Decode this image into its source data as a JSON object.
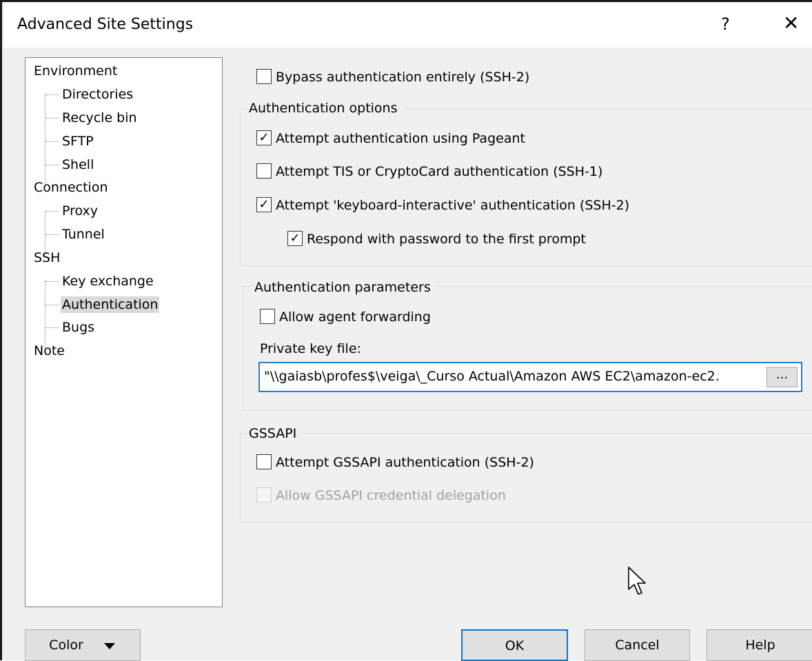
{
  "window": {
    "title": "Advanced Site Settings",
    "help_label": "?",
    "close_label": "✕"
  },
  "tree": {
    "items": [
      {
        "label": "Environment",
        "level": 0
      },
      {
        "label": "Directories",
        "level": 1
      },
      {
        "label": "Recycle bin",
        "level": 1
      },
      {
        "label": "SFTP",
        "level": 1
      },
      {
        "label": "Shell",
        "level": 1
      },
      {
        "label": "Connection",
        "level": 0
      },
      {
        "label": "Proxy",
        "level": 1
      },
      {
        "label": "Tunnel",
        "level": 1
      },
      {
        "label": "SSH",
        "level": 0
      },
      {
        "label": "Key exchange",
        "level": 1
      },
      {
        "label": "Authentication",
        "level": 1,
        "selected": true
      },
      {
        "label": "Bugs",
        "level": 1
      },
      {
        "label": "Note",
        "level": 0
      }
    ]
  },
  "bypass": {
    "label": "Bypass authentication entirely (SSH-2)",
    "checked": false
  },
  "auth_options": {
    "title": "Authentication options",
    "pageant": {
      "label": "Attempt authentication using Pageant",
      "checked": true
    },
    "tis": {
      "label": "Attempt TIS or CryptoCard authentication (SSH-1)",
      "checked": false
    },
    "keyboard": {
      "label": "Attempt 'keyboard-interactive' authentication (SSH-2)",
      "checked": true
    },
    "respond": {
      "label": "Respond with password to the first prompt",
      "checked": true
    }
  },
  "auth_params": {
    "title": "Authentication parameters",
    "agent_forwarding": {
      "label": "Allow agent forwarding",
      "checked": false
    },
    "key_label": "Private key file:",
    "key_value": "\"\\\\gaiasb\\profes$\\veiga\\_Curso Actual\\Amazon AWS EC2\\amazon-ec2.",
    "browse_label": "..."
  },
  "gssapi": {
    "title": "GSSAPI",
    "attempt": {
      "label": "Attempt GSSAPI authentication (SSH-2)",
      "checked": false
    },
    "delegation": {
      "label": "Allow GSSAPI credential delegation",
      "checked": false,
      "disabled": true
    }
  },
  "buttons": {
    "color": "Color",
    "ok": "OK",
    "cancel": "Cancel",
    "help": "Help"
  },
  "colors": {
    "focus_border": "#1e7ed6",
    "default_button_border": "#0078d7",
    "selected_item_bg": "#d9d9d9"
  },
  "check_glyph": "✓"
}
